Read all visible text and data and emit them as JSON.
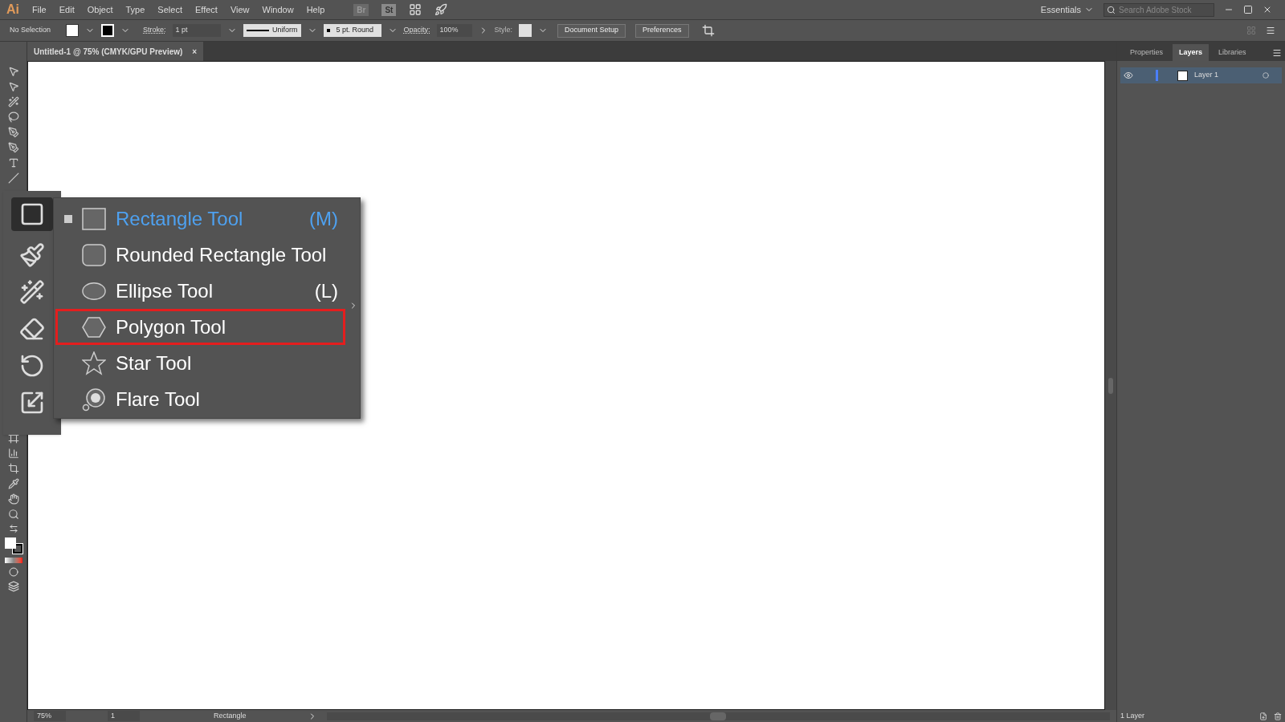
{
  "app_logo": "Ai",
  "menu": [
    "File",
    "Edit",
    "Object",
    "Type",
    "Select",
    "Effect",
    "View",
    "Window",
    "Help"
  ],
  "app_bar": {
    "bridge": "Br",
    "stock": "St",
    "workspace": "Essentials",
    "search": {
      "placeholder": "Search Adobe Stock"
    }
  },
  "control_bar": {
    "selection": "No Selection",
    "stroke_label": "Stroke:",
    "stroke_weight": "1 pt",
    "profile": "Uniform",
    "brush": "5 pt. Round",
    "opacity_label": "Opacity:",
    "opacity": "100%",
    "style_label": "Style:",
    "buttons": [
      "Document Setup",
      "Preferences"
    ]
  },
  "document_tab": {
    "title": "Untitled-1 @ 75% (CMYK/GPU Preview)",
    "close": "×"
  },
  "tool_flyout": {
    "items": [
      {
        "kind": "rectangle",
        "label": "Rectangle Tool",
        "shortcut": "(M)",
        "selected": true,
        "highlighted": false
      },
      {
        "kind": "rounded-rectangle",
        "label": "Rounded Rectangle Tool",
        "selected": false,
        "highlighted": false
      },
      {
        "kind": "ellipse",
        "label": "Ellipse Tool",
        "shortcut": "(L)",
        "selected": false,
        "highlighted": false
      },
      {
        "kind": "polygon",
        "label": "Polygon Tool",
        "selected": false,
        "highlighted": true
      },
      {
        "kind": "star",
        "label": "Star Tool",
        "selected": false,
        "highlighted": false
      },
      {
        "kind": "flare",
        "label": "Flare Tool",
        "selected": false,
        "highlighted": false
      }
    ]
  },
  "panel": {
    "tabs": [
      {
        "label": "Properties",
        "selected": false
      },
      {
        "label": "Layers",
        "selected": true
      },
      {
        "label": "Libraries",
        "selected": false
      }
    ],
    "layers": [
      {
        "name": "Layer 1",
        "visible": true,
        "selected": true
      }
    ],
    "footer": "1 Layer"
  },
  "status_bar": {
    "zoom": "75%",
    "artboard": "1",
    "tool": "Rectangle"
  }
}
